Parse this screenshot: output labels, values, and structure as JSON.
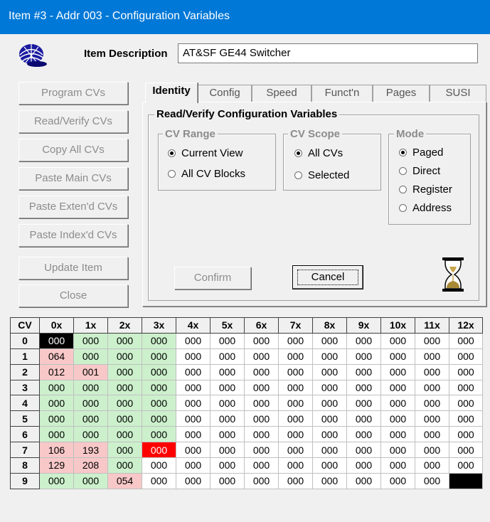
{
  "window": {
    "title": "Item #3 - Addr 003 - Configuration Variables"
  },
  "icons": {
    "logo": "dcc-cap-icon",
    "hourglass": "hourglass-icon"
  },
  "item": {
    "description_label": "Item Description",
    "description_value": "AT&SF GE44 Switcher"
  },
  "left_buttons": [
    {
      "label": "Program CVs",
      "enabled": false
    },
    {
      "label": "Read/Verify CVs",
      "enabled": false
    },
    {
      "label": "Copy All CVs",
      "enabled": false
    },
    {
      "label": "Paste Main CVs",
      "enabled": false
    },
    {
      "label": "Paste Exten'd CVs",
      "enabled": false
    },
    {
      "label": "Paste Index'd CVs",
      "enabled": false
    },
    {
      "label": "Update Item",
      "enabled": false
    },
    {
      "label": "Close",
      "enabled": false
    }
  ],
  "tabs": [
    {
      "label": "Identity",
      "active": true
    },
    {
      "label": "Config",
      "active": false
    },
    {
      "label": "Speed",
      "active": false
    },
    {
      "label": "Funct'n",
      "active": false
    },
    {
      "label": "Pages",
      "active": false
    },
    {
      "label": "SUSI",
      "active": false
    }
  ],
  "dialog": {
    "title": "Read/Verify Configuration Variables",
    "cv_range": {
      "title": "CV Range",
      "options": [
        {
          "label": "Current View",
          "checked": true
        },
        {
          "label": "All CV Blocks",
          "checked": false
        }
      ]
    },
    "cv_scope": {
      "title": "CV Scope",
      "options": [
        {
          "label": "All CVs",
          "checked": true
        },
        {
          "label": "Selected",
          "checked": false
        }
      ]
    },
    "mode": {
      "title": "Mode",
      "options": [
        {
          "label": "Paged",
          "checked": true
        },
        {
          "label": "Direct",
          "checked": false
        },
        {
          "label": "Register",
          "checked": false
        },
        {
          "label": "Address",
          "checked": false
        }
      ]
    },
    "confirm_label": "Confirm",
    "cancel_label": "Cancel"
  },
  "cv_table": {
    "corner_header": "CV",
    "column_headers": [
      "0x",
      "1x",
      "2x",
      "3x",
      "4x",
      "5x",
      "6x",
      "7x",
      "8x",
      "9x",
      "10x",
      "11x",
      "12x"
    ],
    "row_headers": [
      "0",
      "1",
      "2",
      "3",
      "4",
      "5",
      "6",
      "7",
      "8",
      "9"
    ],
    "colors": {
      "w": "#ffffff",
      "g": "#ccf0cc",
      "p": "#f8c8c8",
      "r": "#ff0000",
      "k": "#000000"
    },
    "rows": [
      {
        "values": [
          "000",
          "000",
          "000",
          "000",
          "000",
          "000",
          "000",
          "000",
          "000",
          "000",
          "000",
          "000",
          "000"
        ],
        "styles": [
          "k",
          "g",
          "g",
          "g",
          "w",
          "w",
          "w",
          "w",
          "w",
          "w",
          "w",
          "w",
          "w"
        ]
      },
      {
        "values": [
          "064",
          "000",
          "000",
          "000",
          "000",
          "000",
          "000",
          "000",
          "000",
          "000",
          "000",
          "000",
          "000"
        ],
        "styles": [
          "p",
          "g",
          "g",
          "g",
          "w",
          "w",
          "w",
          "w",
          "w",
          "w",
          "w",
          "w",
          "w"
        ]
      },
      {
        "values": [
          "012",
          "001",
          "000",
          "000",
          "000",
          "000",
          "000",
          "000",
          "000",
          "000",
          "000",
          "000",
          "000"
        ],
        "styles": [
          "p",
          "p",
          "g",
          "g",
          "w",
          "w",
          "w",
          "w",
          "w",
          "w",
          "w",
          "w",
          "w"
        ]
      },
      {
        "values": [
          "000",
          "000",
          "000",
          "000",
          "000",
          "000",
          "000",
          "000",
          "000",
          "000",
          "000",
          "000",
          "000"
        ],
        "styles": [
          "g",
          "g",
          "g",
          "g",
          "w",
          "w",
          "w",
          "w",
          "w",
          "w",
          "w",
          "w",
          "w"
        ]
      },
      {
        "values": [
          "000",
          "000",
          "000",
          "000",
          "000",
          "000",
          "000",
          "000",
          "000",
          "000",
          "000",
          "000",
          "000"
        ],
        "styles": [
          "g",
          "g",
          "g",
          "g",
          "w",
          "w",
          "w",
          "w",
          "w",
          "w",
          "w",
          "w",
          "w"
        ]
      },
      {
        "values": [
          "000",
          "000",
          "000",
          "000",
          "000",
          "000",
          "000",
          "000",
          "000",
          "000",
          "000",
          "000",
          "000"
        ],
        "styles": [
          "g",
          "g",
          "g",
          "g",
          "w",
          "w",
          "w",
          "w",
          "w",
          "w",
          "w",
          "w",
          "w"
        ]
      },
      {
        "values": [
          "000",
          "000",
          "000",
          "000",
          "000",
          "000",
          "000",
          "000",
          "000",
          "000",
          "000",
          "000",
          "000"
        ],
        "styles": [
          "g",
          "g",
          "g",
          "g",
          "w",
          "w",
          "w",
          "w",
          "w",
          "w",
          "w",
          "w",
          "w"
        ]
      },
      {
        "values": [
          "106",
          "193",
          "000",
          "000",
          "000",
          "000",
          "000",
          "000",
          "000",
          "000",
          "000",
          "000",
          "000"
        ],
        "styles": [
          "p",
          "p",
          "g",
          "r",
          "w",
          "w",
          "w",
          "w",
          "w",
          "w",
          "w",
          "w",
          "w"
        ]
      },
      {
        "values": [
          "129",
          "208",
          "000",
          "000",
          "000",
          "000",
          "000",
          "000",
          "000",
          "000",
          "000",
          "000",
          "000"
        ],
        "styles": [
          "p",
          "p",
          "g",
          "w",
          "w",
          "w",
          "w",
          "w",
          "w",
          "w",
          "w",
          "w",
          "w"
        ]
      },
      {
        "values": [
          "000",
          "000",
          "054",
          "000",
          "000",
          "000",
          "000",
          "000",
          "000",
          "000",
          "000",
          "000",
          ""
        ],
        "styles": [
          "g",
          "g",
          "p",
          "w",
          "w",
          "w",
          "w",
          "w",
          "w",
          "w",
          "w",
          "w",
          "k"
        ]
      }
    ]
  }
}
